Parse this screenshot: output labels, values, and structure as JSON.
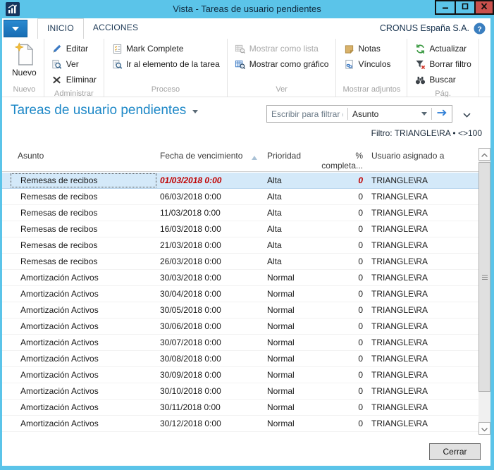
{
  "window": {
    "title": "Vista - Tareas de usuario pendientes"
  },
  "tabbar": {
    "tabs": [
      "INICIO",
      "ACCIONES"
    ],
    "company": "CRONUS España S.A."
  },
  "ribbon": {
    "groups": [
      {
        "label": "Nuevo",
        "items": [
          {
            "label": "Nuevo",
            "icon": "new-document-icon",
            "size": "large"
          }
        ]
      },
      {
        "label": "Administrar",
        "items": [
          {
            "label": "Editar",
            "icon": "edit-pencil-icon"
          },
          {
            "label": "Ver",
            "icon": "view-magnifier-icon"
          },
          {
            "label": "Eliminar",
            "icon": "delete-x-icon"
          }
        ]
      },
      {
        "label": "Proceso",
        "items": [
          {
            "label": "Mark Complete",
            "icon": "mark-complete-icon"
          },
          {
            "label": "Ir al elemento de la tarea",
            "icon": "goto-task-item-icon"
          }
        ]
      },
      {
        "label": "Ver",
        "items": [
          {
            "label": "Mostrar como lista",
            "icon": "show-as-list-icon",
            "disabled": true
          },
          {
            "label": "Mostrar como gráfico",
            "icon": "show-as-chart-icon"
          }
        ]
      },
      {
        "label": "Mostrar adjuntos",
        "items": [
          {
            "label": "Notas",
            "icon": "notes-icon"
          },
          {
            "label": "Vínculos",
            "icon": "links-icon"
          }
        ]
      },
      {
        "label": "Pág.",
        "items": [
          {
            "label": "Actualizar",
            "icon": "refresh-icon"
          },
          {
            "label": "Borrar filtro",
            "icon": "clear-filter-icon"
          },
          {
            "label": "Buscar",
            "icon": "binoculars-icon"
          }
        ]
      }
    ]
  },
  "page": {
    "title": "Tareas de usuario pendientes",
    "filter_placeholder": "Escribir para filtrar (...",
    "filter_field": "Asunto",
    "filter_info": "Filtro: TRIANGLE\\RA • <>100"
  },
  "table": {
    "columns": [
      "Asunto",
      "Fecha de vencimiento",
      "Prioridad",
      "% completa...",
      "Usuario asignado a"
    ],
    "rows": [
      {
        "subject": "Remesas de recibos",
        "due": "01/03/2018 0:00",
        "priority": "Alta",
        "pct": "0",
        "user": "TRIANGLE\\RA",
        "selected": true,
        "overdue": true
      },
      {
        "subject": "Remesas de recibos",
        "due": "06/03/2018 0:00",
        "priority": "Alta",
        "pct": "0",
        "user": "TRIANGLE\\RA"
      },
      {
        "subject": "Remesas de recibos",
        "due": "11/03/2018 0:00",
        "priority": "Alta",
        "pct": "0",
        "user": "TRIANGLE\\RA"
      },
      {
        "subject": "Remesas de recibos",
        "due": "16/03/2018 0:00",
        "priority": "Alta",
        "pct": "0",
        "user": "TRIANGLE\\RA"
      },
      {
        "subject": "Remesas de recibos",
        "due": "21/03/2018 0:00",
        "priority": "Alta",
        "pct": "0",
        "user": "TRIANGLE\\RA"
      },
      {
        "subject": "Remesas de recibos",
        "due": "26/03/2018 0:00",
        "priority": "Alta",
        "pct": "0",
        "user": "TRIANGLE\\RA"
      },
      {
        "subject": "Amortización Activos",
        "due": "30/03/2018 0:00",
        "priority": "Normal",
        "pct": "0",
        "user": "TRIANGLE\\RA"
      },
      {
        "subject": "Amortización Activos",
        "due": "30/04/2018 0:00",
        "priority": "Normal",
        "pct": "0",
        "user": "TRIANGLE\\RA"
      },
      {
        "subject": "Amortización Activos",
        "due": "30/05/2018 0:00",
        "priority": "Normal",
        "pct": "0",
        "user": "TRIANGLE\\RA"
      },
      {
        "subject": "Amortización Activos",
        "due": "30/06/2018 0:00",
        "priority": "Normal",
        "pct": "0",
        "user": "TRIANGLE\\RA"
      },
      {
        "subject": "Amortización Activos",
        "due": "30/07/2018 0:00",
        "priority": "Normal",
        "pct": "0",
        "user": "TRIANGLE\\RA"
      },
      {
        "subject": "Amortización Activos",
        "due": "30/08/2018 0:00",
        "priority": "Normal",
        "pct": "0",
        "user": "TRIANGLE\\RA"
      },
      {
        "subject": "Amortización Activos",
        "due": "30/09/2018 0:00",
        "priority": "Normal",
        "pct": "0",
        "user": "TRIANGLE\\RA"
      },
      {
        "subject": "Amortización Activos",
        "due": "30/10/2018 0:00",
        "priority": "Normal",
        "pct": "0",
        "user": "TRIANGLE\\RA"
      },
      {
        "subject": "Amortización Activos",
        "due": "30/11/2018 0:00",
        "priority": "Normal",
        "pct": "0",
        "user": "TRIANGLE\\RA"
      },
      {
        "subject": "Amortización Activos",
        "due": "30/12/2018 0:00",
        "priority": "Normal",
        "pct": "0",
        "user": "TRIANGLE\\RA"
      }
    ]
  },
  "footer": {
    "close_label": "Cerrar"
  },
  "colors": {
    "titlebar": "#5bc4e9",
    "close_button": "#c9504c",
    "accent_blue": "#1e7bc4",
    "page_title": "#1e88c7",
    "overdue_red": "#c00000",
    "selection": "#d4e9f9"
  }
}
